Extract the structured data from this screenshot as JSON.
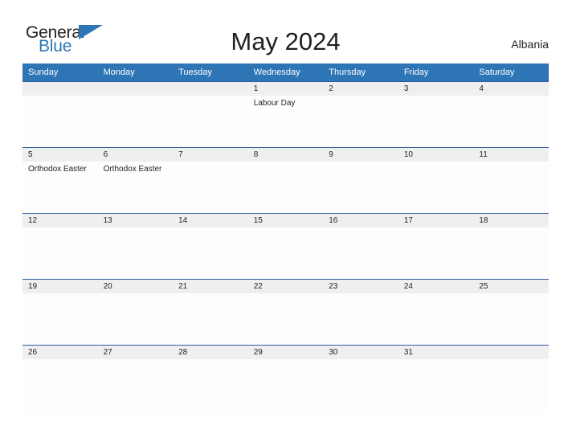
{
  "brand": {
    "name_part1": "General",
    "name_part2": "Blue",
    "primary_color": "#2e75b6",
    "flag_icon": "blue-triangle-flag-icon"
  },
  "header": {
    "title": "May 2024",
    "locale": "Albania"
  },
  "calendar": {
    "month": "May",
    "year": "2024",
    "weekday_headers": [
      "Sunday",
      "Monday",
      "Tuesday",
      "Wednesday",
      "Thursday",
      "Friday",
      "Saturday"
    ],
    "weeks": [
      [
        {
          "date": "",
          "events": []
        },
        {
          "date": "",
          "events": []
        },
        {
          "date": "",
          "events": []
        },
        {
          "date": "1",
          "events": [
            "Labour Day"
          ]
        },
        {
          "date": "2",
          "events": []
        },
        {
          "date": "3",
          "events": []
        },
        {
          "date": "4",
          "events": []
        }
      ],
      [
        {
          "date": "5",
          "events": [
            "Orthodox Easter"
          ]
        },
        {
          "date": "6",
          "events": [
            "Orthodox Easter"
          ]
        },
        {
          "date": "7",
          "events": []
        },
        {
          "date": "8",
          "events": []
        },
        {
          "date": "9",
          "events": []
        },
        {
          "date": "10",
          "events": []
        },
        {
          "date": "11",
          "events": []
        }
      ],
      [
        {
          "date": "12",
          "events": []
        },
        {
          "date": "13",
          "events": []
        },
        {
          "date": "14",
          "events": []
        },
        {
          "date": "15",
          "events": []
        },
        {
          "date": "16",
          "events": []
        },
        {
          "date": "17",
          "events": []
        },
        {
          "date": "18",
          "events": []
        }
      ],
      [
        {
          "date": "19",
          "events": []
        },
        {
          "date": "20",
          "events": []
        },
        {
          "date": "21",
          "events": []
        },
        {
          "date": "22",
          "events": []
        },
        {
          "date": "23",
          "events": []
        },
        {
          "date": "24",
          "events": []
        },
        {
          "date": "25",
          "events": []
        }
      ],
      [
        {
          "date": "26",
          "events": []
        },
        {
          "date": "27",
          "events": []
        },
        {
          "date": "28",
          "events": []
        },
        {
          "date": "29",
          "events": []
        },
        {
          "date": "30",
          "events": []
        },
        {
          "date": "31",
          "events": []
        },
        {
          "date": "",
          "events": []
        }
      ]
    ]
  }
}
